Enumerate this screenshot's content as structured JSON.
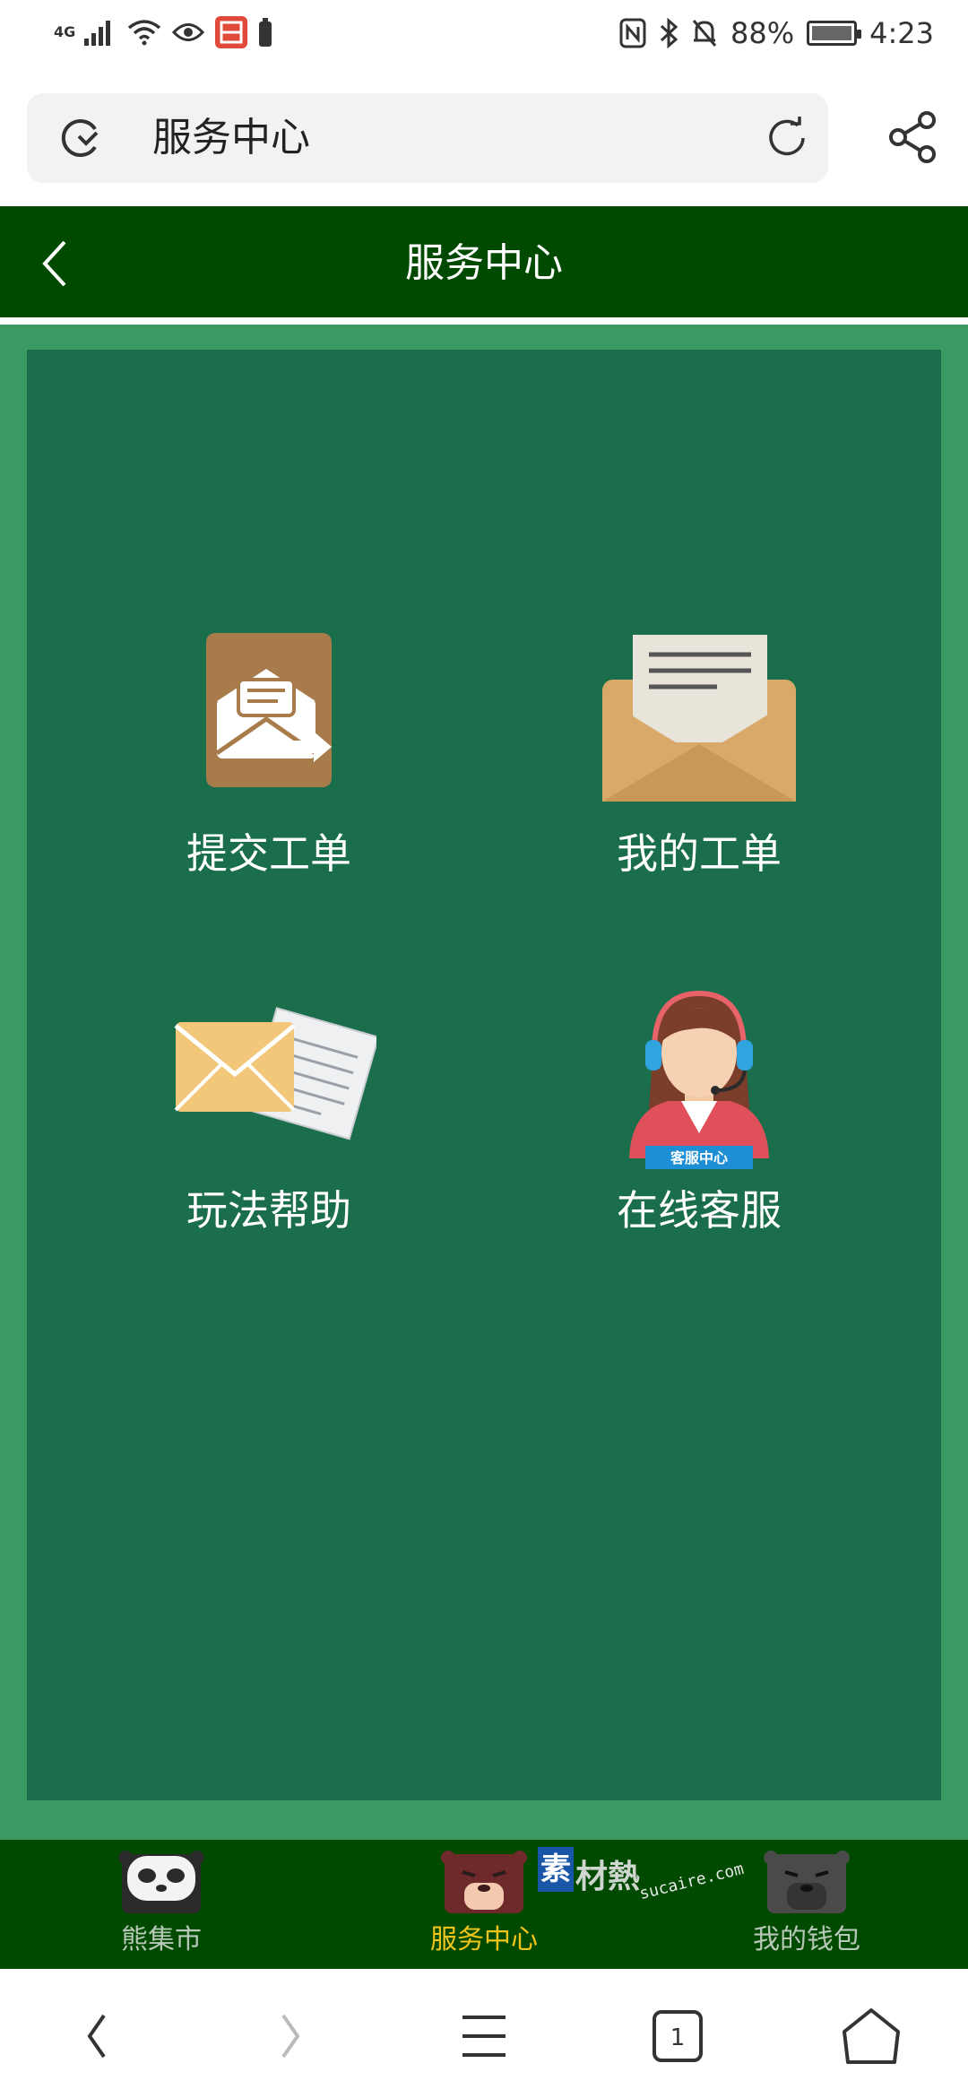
{
  "status_bar": {
    "network": "4G",
    "battery_percent": "88%",
    "time": "4:23",
    "icons": [
      "signal-icon",
      "wifi-icon",
      "eye-icon",
      "app-notification-icon",
      "battery-small-icon",
      "nfc-icon",
      "bluetooth-icon",
      "silent-bell-icon",
      "charging-battery-icon"
    ]
  },
  "browser": {
    "url_text": "服务中心"
  },
  "header": {
    "title": "服务中心"
  },
  "tiles": [
    {
      "label": "提交工单",
      "icon": "submit-ticket-envelope-icon"
    },
    {
      "label": "我的工单",
      "icon": "my-tickets-envelope-icon"
    },
    {
      "label": "玩法帮助",
      "icon": "help-letter-icon"
    },
    {
      "label": "在线客服",
      "icon": "customer-service-agent-icon"
    }
  ],
  "agent_badge_text": "客服中心",
  "tabbar": {
    "tabs": [
      {
        "label": "熊集市",
        "active": false
      },
      {
        "label": "服务中心",
        "active": true
      },
      {
        "label": "我的钱包",
        "active": false
      }
    ]
  },
  "watermark": {
    "box": "素",
    "text": "材熱",
    "url": "sucaire.com"
  },
  "system_nav": {
    "tab_count": "1"
  },
  "colors": {
    "header_bg": "#004a00",
    "content_bg": "#1a6e4c",
    "content_border": "#3a9a62",
    "active_tab": "#f0c419"
  }
}
